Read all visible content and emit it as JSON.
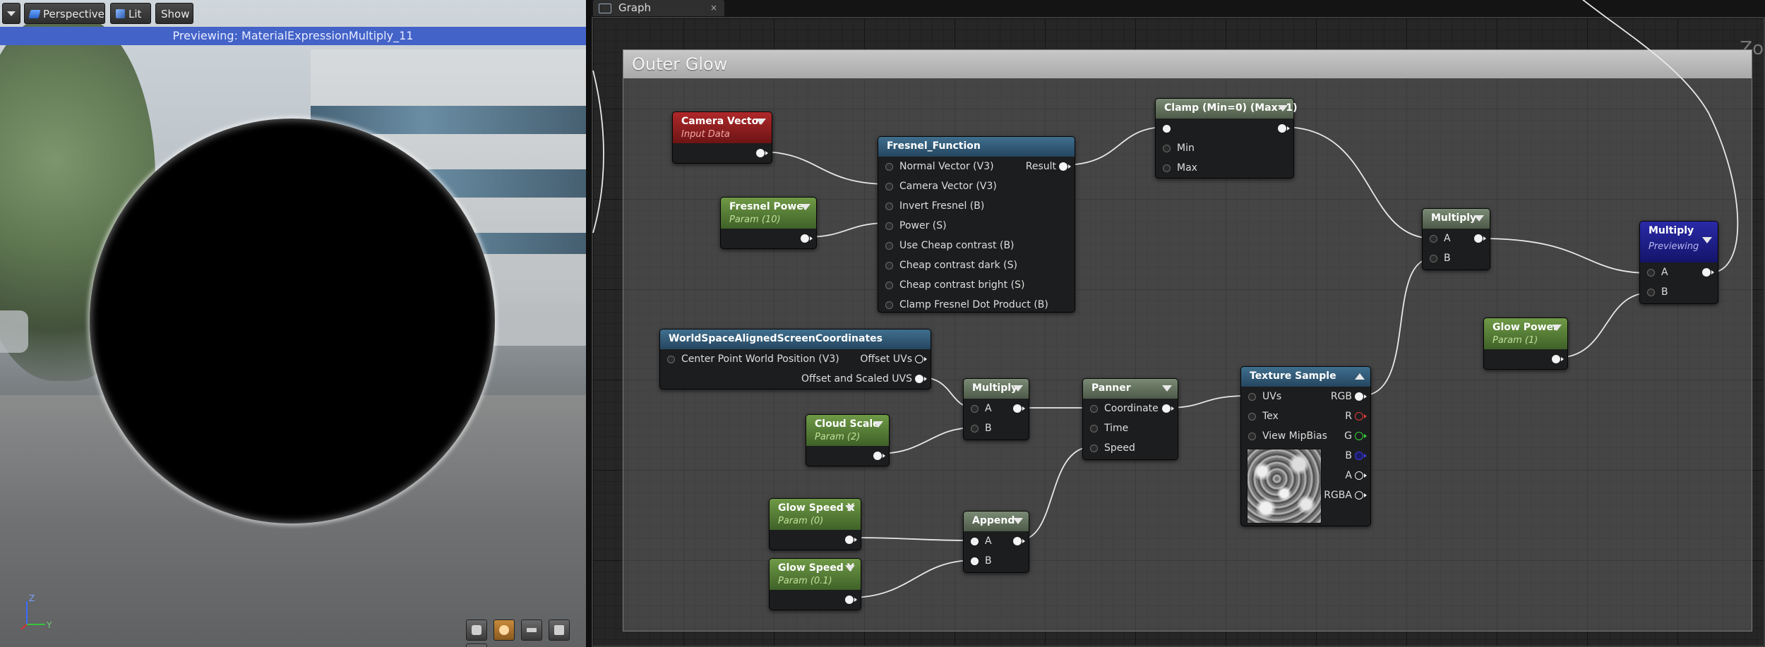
{
  "viewport": {
    "toolbar": {
      "perspective_label": "Perspective",
      "lit_label": "Lit",
      "show_label": "Show"
    },
    "preview_text": "Previewing: MaterialExpressionMultiply_11",
    "axis": {
      "z": "Z",
      "y": "Y"
    }
  },
  "graph": {
    "tab_label": "Graph",
    "tab_close": "×",
    "zoom_label": "Zo",
    "comment_title": "Outer Glow"
  },
  "nodes": {
    "camera_vector": {
      "title": "Camera Vector",
      "sub": "Input Data"
    },
    "fresnel_power": {
      "title": "Fresnel Power",
      "sub": "Param (10)"
    },
    "fresnel_function": {
      "title": "Fresnel_Function",
      "inputs": [
        "Normal Vector (V3)",
        "Camera Vector (V3)",
        "Invert Fresnel (B)",
        "Power (S)",
        "Use Cheap contrast (B)",
        "Cheap contrast dark (S)",
        "Cheap contrast bright (S)",
        "Clamp Fresnel Dot Product (B)"
      ],
      "output": "Result"
    },
    "clamp": {
      "title": "Clamp (Min=0) (Max=1)",
      "inputs": [
        "",
        "Min",
        "Max"
      ]
    },
    "multiply_top": {
      "title": "Multiply",
      "inputs": [
        "A",
        "B"
      ]
    },
    "multiply_final": {
      "title": "Multiply",
      "sub": "Previewing",
      "inputs": [
        "A",
        "B"
      ]
    },
    "glow_power": {
      "title": "Glow Power",
      "sub": "Param (1)"
    },
    "world_space": {
      "title": "WorldSpaceAlignedScreenCoordinates",
      "input": "Center Point World Position (V3)",
      "outputs": [
        "Offset UVs",
        "Offset and Scaled UVS"
      ]
    },
    "multiply_mid": {
      "title": "Multiply",
      "inputs": [
        "A",
        "B"
      ]
    },
    "cloud_scale": {
      "title": "Cloud Scale",
      "sub": "Param (2)"
    },
    "panner": {
      "title": "Panner",
      "inputs": [
        "Coordinate",
        "Time",
        "Speed"
      ]
    },
    "texture_sample": {
      "title": "Texture Sample",
      "inputs": [
        "UVs",
        "Tex",
        "View MipBias"
      ],
      "outputs": [
        "RGB",
        "R",
        "G",
        "B",
        "A",
        "RGBA"
      ]
    },
    "glow_speed_x": {
      "title": "Glow Speed X",
      "sub": "Param (0)"
    },
    "glow_speed_y": {
      "title": "Glow Speed Y",
      "sub": "Param (0.1)"
    },
    "append": {
      "title": "Append",
      "inputs": [
        "A",
        "B"
      ]
    }
  },
  "colors": {
    "preview_bar": "#4363c8",
    "param_node": "#6f9a46",
    "input_data_node": "#b0282a",
    "function_node": "#3f6f8e",
    "previewing_node": "#2a2aa8"
  }
}
